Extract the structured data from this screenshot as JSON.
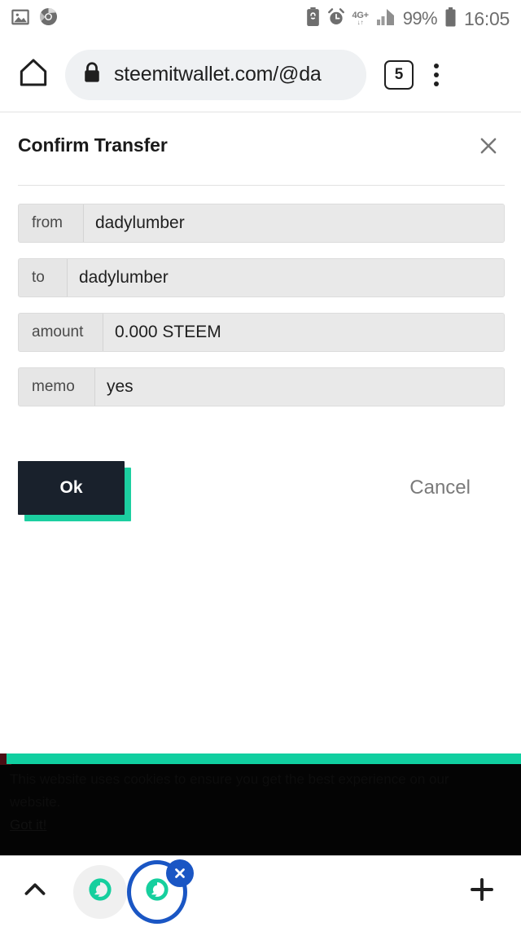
{
  "statusbar": {
    "left_icons": [
      "image-icon",
      "chrome-icon"
    ],
    "right_icons": [
      "battery-saver-icon",
      "alarm-icon",
      "signal-icon",
      "battery-icon"
    ],
    "network_label": "4G+",
    "network_sub": "↓↑",
    "battery_percent": "99%",
    "clock": "16:05"
  },
  "toolbar": {
    "home_icon": "home-icon",
    "lock_icon": "lock-icon",
    "url": "steemitwallet.com/@da",
    "tab_count": "5",
    "menu_icon": "overflow-menu-icon"
  },
  "dialog": {
    "title": "Confirm Transfer",
    "close_label": "×",
    "fields": [
      {
        "label": "from",
        "value": "dadylumber",
        "label_width": 80
      },
      {
        "label": "to",
        "value": "dadylumber",
        "label_width": 60
      },
      {
        "label": "amount",
        "value": "0.000 STEEM",
        "label_width": 104
      },
      {
        "label": "memo",
        "value": "yes",
        "label_width": 94
      }
    ],
    "ok_label": "Ok",
    "cancel_label": "Cancel"
  },
  "banner": {
    "text": "This website uses cookies to ensure you get the best experience on our website.",
    "link_label": "Got it!"
  },
  "bottombar": {
    "expand_icon": "chevron-up-icon",
    "tabs": [
      {
        "icon": "steem-logo-icon",
        "state": "inactive"
      },
      {
        "icon": "steem-logo-icon",
        "state": "active",
        "close_label": "×"
      }
    ],
    "add_icon": "plus-icon"
  },
  "colors": {
    "accent_teal": "#1ccfa0",
    "button_dark": "#19212c",
    "tab_blue": "#1a56c4",
    "field_bg": "#e9e9e9"
  }
}
